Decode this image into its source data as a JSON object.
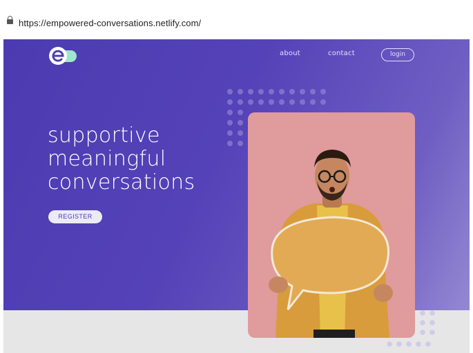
{
  "browser": {
    "url": "https://empowered-conversations.netlify.com/",
    "lock_icon": "lock-icon"
  },
  "nav": {
    "about": "about",
    "contact": "contact",
    "login": "login"
  },
  "hero": {
    "headline": [
      "supportive",
      "meaningful",
      "conversations"
    ],
    "register": "REGISTER"
  },
  "colors": {
    "brand_purple": "#4c3bb0",
    "logo_mint": "#9fe6cf",
    "card_pink": "#e09b9c",
    "bubble_orange": "#e2aa55",
    "footer_gray": "#e6e6e7"
  },
  "icons": {
    "logo": "empowered-logo",
    "speech_bubble": "speech-bubble-sign"
  }
}
